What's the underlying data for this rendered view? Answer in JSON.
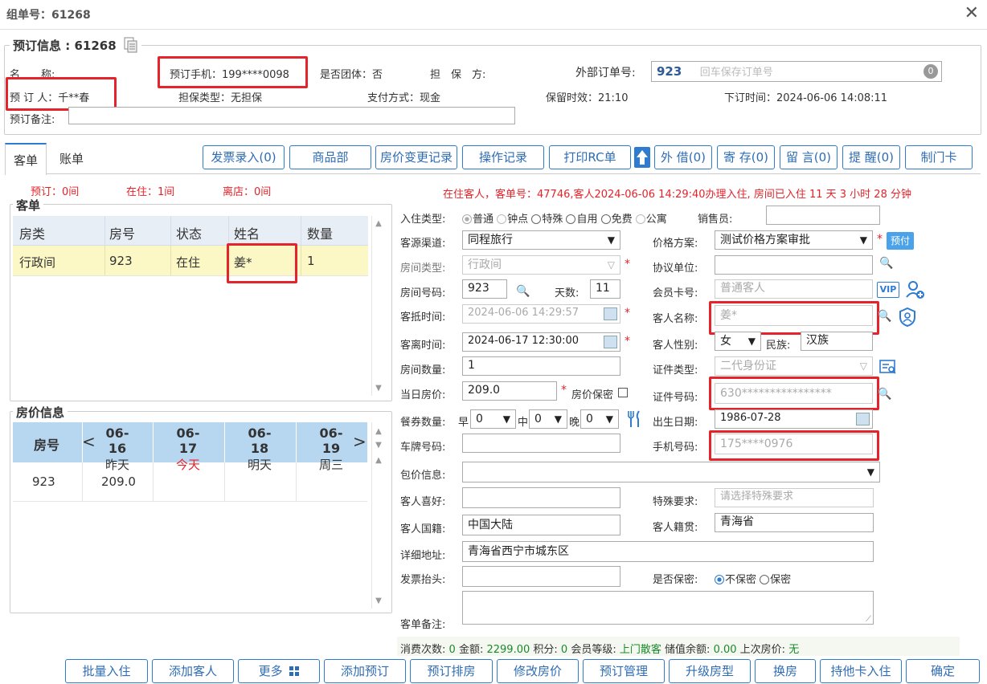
{
  "window": {
    "title": "组单号：61268",
    "close_icon": "close-icon"
  },
  "booking": {
    "legend": "预订信息 : 61268",
    "name_label": "名　　称:",
    "phone_text": "预订手机：199****0098",
    "group_text": "是否团体：否",
    "guarantor_label": "担　保　方:",
    "ext_order_label": "外部订单号:",
    "ext_order_value": "923",
    "ext_order_placeholder": "回车保存订单号",
    "ext_order_badge": "0",
    "booker_text": "预 订 人：千**春",
    "guarantee_type": "担保类型：无担保",
    "pay_method": "支付方式：现金",
    "hold_time": "保留时效：21:10",
    "order_time": "下订时间：2024-06-06 14:08:11",
    "remark_label": "预订备注:"
  },
  "tabs": [
    {
      "label": "客单"
    },
    {
      "label": "账单"
    }
  ],
  "toolbar": [
    "发票录入(0)",
    "商品部",
    "房价变更记录",
    "操作记录",
    "打印RC单",
    "外 借(0)",
    "寄 存(0)",
    "留 言(0)",
    "提 醒(0)",
    "制门卡"
  ],
  "stats": {
    "booked": "预订：0间",
    "in_house": "在住：1间",
    "left": "离店：0间"
  },
  "status_msg": "在住客人，客单号：47746,客人2024-06-06 14:29:40办理入住, 房间已入住 11 天 3 小时 28 分钟",
  "guest_list": {
    "legend": "客单",
    "headers": [
      "房类",
      "房号",
      "状态",
      "姓名",
      "数量"
    ],
    "rows": [
      [
        "行政间",
        "923",
        "在住",
        "姜*",
        "1"
      ]
    ]
  },
  "price_info": {
    "legend": "房价信息",
    "room_header": "房号",
    "days": [
      {
        "date": "06-16",
        "label": "昨天"
      },
      {
        "date": "06-17",
        "label": "今天"
      },
      {
        "date": "06-18",
        "label": "明天"
      },
      {
        "date": "06-19",
        "label": "周三"
      }
    ],
    "rows": [
      {
        "room": "923",
        "prices": [
          "209.0",
          "",
          "",
          ""
        ]
      }
    ]
  },
  "form": {
    "checkin_type_label": "入住类型:",
    "checkin_types": [
      "普通",
      "钟点",
      "特殊",
      "自用",
      "免费",
      "公寓"
    ],
    "sales_label": "销售员:",
    "source_label": "客源渠道:",
    "source_value": "同程旅行",
    "price_plan_label": "价格方案:",
    "price_plan_value": "测试价格方案审批",
    "prepay_badge": "预付",
    "room_type_label": "房间类型:",
    "room_type_value": "行政间",
    "agreement_label": "协议单位:",
    "room_no_label": "房间号码:",
    "room_no_value": "923",
    "days_label": "天数:",
    "days_value": "11",
    "member_label": "会员卡号:",
    "member_placeholder": "普通客人",
    "vip_badge": "VIP",
    "arrive_label": "客抵时间:",
    "arrive_value": "2024-06-06 14:29:57",
    "guest_name_label": "客人名称:",
    "guest_name_value": "姜*",
    "depart_label": "客离时间:",
    "depart_value": "2024-06-17 12:30:00",
    "gender_label": "客人性别:",
    "gender_value": "女",
    "ethnic_label": "民族:",
    "ethnic_value": "汉族",
    "room_count_label": "房间数量:",
    "room_count_value": "1",
    "id_type_label": "证件类型:",
    "id_type_value": "二代身份证",
    "rate_label": "当日房价:",
    "rate_value": "209.0",
    "rate_secret_label": "房价保密",
    "id_no_label": "证件号码:",
    "id_no_value": "630****************",
    "meal_label": "餐券数量:",
    "breakfast_label": "早",
    "breakfast_value": "0",
    "lunch_label": "中",
    "lunch_value": "0",
    "dinner_label": "晚",
    "dinner_value": "0",
    "birthday_label": "出生日期:",
    "birthday_value": "1986-07-28",
    "plate_label": "车牌号码:",
    "mobile_label": "手机号码:",
    "mobile_value": "175****0976",
    "package_label": "包价信息:",
    "hobby_label": "客人喜好:",
    "special_label": "特殊要求:",
    "special_placeholder": "请选择特殊要求",
    "nationality_label": "客人国籍:",
    "nationality_value": "中国大陆",
    "native_label": "客人籍贯:",
    "native_value": "青海省",
    "address_label": "详细地址:",
    "address_value": "青海省西宁市城东区",
    "invoice_label": "发票抬头:",
    "secret_label": "是否保密:",
    "secret_no": "不保密",
    "secret_yes": "保密",
    "remark_label": "客单备注:"
  },
  "summary": {
    "visits_label": "消费次数:",
    "visits": "0",
    "amount_label": "金额:",
    "amount": "2299.00",
    "points_label": "积分:",
    "points": "0",
    "level_label": "会员等级:",
    "level": "上门散客",
    "balance_label": "储值余额:",
    "balance": "0.00",
    "last_price_label": "上次房价:",
    "last_price": "无"
  },
  "bottom_buttons": [
    "批量入住",
    "添加客人",
    "更多",
    "添加预订",
    "预订排房",
    "修改房价",
    "预订管理",
    "升级房型",
    "换房",
    "持他卡入住",
    "确定"
  ],
  "colors": {
    "accent": "#2e7bd0",
    "highlight": "#e4232a",
    "selected_row": "#fbf8c6",
    "header_bg": "#e8eef6"
  }
}
